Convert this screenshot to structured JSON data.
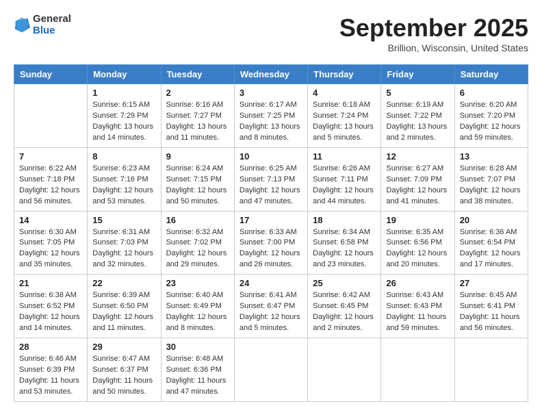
{
  "header": {
    "logo_general": "General",
    "logo_blue": "Blue",
    "month_title": "September 2025",
    "location": "Brillion, Wisconsin, United States"
  },
  "days_of_week": [
    "Sunday",
    "Monday",
    "Tuesday",
    "Wednesday",
    "Thursday",
    "Friday",
    "Saturday"
  ],
  "weeks": [
    [
      {
        "day": "",
        "sunrise": "",
        "sunset": "",
        "daylight": ""
      },
      {
        "day": "1",
        "sunrise": "Sunrise: 6:15 AM",
        "sunset": "Sunset: 7:29 PM",
        "daylight": "Daylight: 13 hours and 14 minutes."
      },
      {
        "day": "2",
        "sunrise": "Sunrise: 6:16 AM",
        "sunset": "Sunset: 7:27 PM",
        "daylight": "Daylight: 13 hours and 11 minutes."
      },
      {
        "day": "3",
        "sunrise": "Sunrise: 6:17 AM",
        "sunset": "Sunset: 7:25 PM",
        "daylight": "Daylight: 13 hours and 8 minutes."
      },
      {
        "day": "4",
        "sunrise": "Sunrise: 6:18 AM",
        "sunset": "Sunset: 7:24 PM",
        "daylight": "Daylight: 13 hours and 5 minutes."
      },
      {
        "day": "5",
        "sunrise": "Sunrise: 6:19 AM",
        "sunset": "Sunset: 7:22 PM",
        "daylight": "Daylight: 13 hours and 2 minutes."
      },
      {
        "day": "6",
        "sunrise": "Sunrise: 6:20 AM",
        "sunset": "Sunset: 7:20 PM",
        "daylight": "Daylight: 12 hours and 59 minutes."
      }
    ],
    [
      {
        "day": "7",
        "sunrise": "Sunrise: 6:22 AM",
        "sunset": "Sunset: 7:18 PM",
        "daylight": "Daylight: 12 hours and 56 minutes."
      },
      {
        "day": "8",
        "sunrise": "Sunrise: 6:23 AM",
        "sunset": "Sunset: 7:16 PM",
        "daylight": "Daylight: 12 hours and 53 minutes."
      },
      {
        "day": "9",
        "sunrise": "Sunrise: 6:24 AM",
        "sunset": "Sunset: 7:15 PM",
        "daylight": "Daylight: 12 hours and 50 minutes."
      },
      {
        "day": "10",
        "sunrise": "Sunrise: 6:25 AM",
        "sunset": "Sunset: 7:13 PM",
        "daylight": "Daylight: 12 hours and 47 minutes."
      },
      {
        "day": "11",
        "sunrise": "Sunrise: 6:26 AM",
        "sunset": "Sunset: 7:11 PM",
        "daylight": "Daylight: 12 hours and 44 minutes."
      },
      {
        "day": "12",
        "sunrise": "Sunrise: 6:27 AM",
        "sunset": "Sunset: 7:09 PM",
        "daylight": "Daylight: 12 hours and 41 minutes."
      },
      {
        "day": "13",
        "sunrise": "Sunrise: 6:28 AM",
        "sunset": "Sunset: 7:07 PM",
        "daylight": "Daylight: 12 hours and 38 minutes."
      }
    ],
    [
      {
        "day": "14",
        "sunrise": "Sunrise: 6:30 AM",
        "sunset": "Sunset: 7:05 PM",
        "daylight": "Daylight: 12 hours and 35 minutes."
      },
      {
        "day": "15",
        "sunrise": "Sunrise: 6:31 AM",
        "sunset": "Sunset: 7:03 PM",
        "daylight": "Daylight: 12 hours and 32 minutes."
      },
      {
        "day": "16",
        "sunrise": "Sunrise: 6:32 AM",
        "sunset": "Sunset: 7:02 PM",
        "daylight": "Daylight: 12 hours and 29 minutes."
      },
      {
        "day": "17",
        "sunrise": "Sunrise: 6:33 AM",
        "sunset": "Sunset: 7:00 PM",
        "daylight": "Daylight: 12 hours and 26 minutes."
      },
      {
        "day": "18",
        "sunrise": "Sunrise: 6:34 AM",
        "sunset": "Sunset: 6:58 PM",
        "daylight": "Daylight: 12 hours and 23 minutes."
      },
      {
        "day": "19",
        "sunrise": "Sunrise: 6:35 AM",
        "sunset": "Sunset: 6:56 PM",
        "daylight": "Daylight: 12 hours and 20 minutes."
      },
      {
        "day": "20",
        "sunrise": "Sunrise: 6:36 AM",
        "sunset": "Sunset: 6:54 PM",
        "daylight": "Daylight: 12 hours and 17 minutes."
      }
    ],
    [
      {
        "day": "21",
        "sunrise": "Sunrise: 6:38 AM",
        "sunset": "Sunset: 6:52 PM",
        "daylight": "Daylight: 12 hours and 14 minutes."
      },
      {
        "day": "22",
        "sunrise": "Sunrise: 6:39 AM",
        "sunset": "Sunset: 6:50 PM",
        "daylight": "Daylight: 12 hours and 11 minutes."
      },
      {
        "day": "23",
        "sunrise": "Sunrise: 6:40 AM",
        "sunset": "Sunset: 6:49 PM",
        "daylight": "Daylight: 12 hours and 8 minutes."
      },
      {
        "day": "24",
        "sunrise": "Sunrise: 6:41 AM",
        "sunset": "Sunset: 6:47 PM",
        "daylight": "Daylight: 12 hours and 5 minutes."
      },
      {
        "day": "25",
        "sunrise": "Sunrise: 6:42 AM",
        "sunset": "Sunset: 6:45 PM",
        "daylight": "Daylight: 12 hours and 2 minutes."
      },
      {
        "day": "26",
        "sunrise": "Sunrise: 6:43 AM",
        "sunset": "Sunset: 6:43 PM",
        "daylight": "Daylight: 11 hours and 59 minutes."
      },
      {
        "day": "27",
        "sunrise": "Sunrise: 6:45 AM",
        "sunset": "Sunset: 6:41 PM",
        "daylight": "Daylight: 11 hours and 56 minutes."
      }
    ],
    [
      {
        "day": "28",
        "sunrise": "Sunrise: 6:46 AM",
        "sunset": "Sunset: 6:39 PM",
        "daylight": "Daylight: 11 hours and 53 minutes."
      },
      {
        "day": "29",
        "sunrise": "Sunrise: 6:47 AM",
        "sunset": "Sunset: 6:37 PM",
        "daylight": "Daylight: 11 hours and 50 minutes."
      },
      {
        "day": "30",
        "sunrise": "Sunrise: 6:48 AM",
        "sunset": "Sunset: 6:36 PM",
        "daylight": "Daylight: 11 hours and 47 minutes."
      },
      {
        "day": "",
        "sunrise": "",
        "sunset": "",
        "daylight": ""
      },
      {
        "day": "",
        "sunrise": "",
        "sunset": "",
        "daylight": ""
      },
      {
        "day": "",
        "sunrise": "",
        "sunset": "",
        "daylight": ""
      },
      {
        "day": "",
        "sunrise": "",
        "sunset": "",
        "daylight": ""
      }
    ]
  ]
}
